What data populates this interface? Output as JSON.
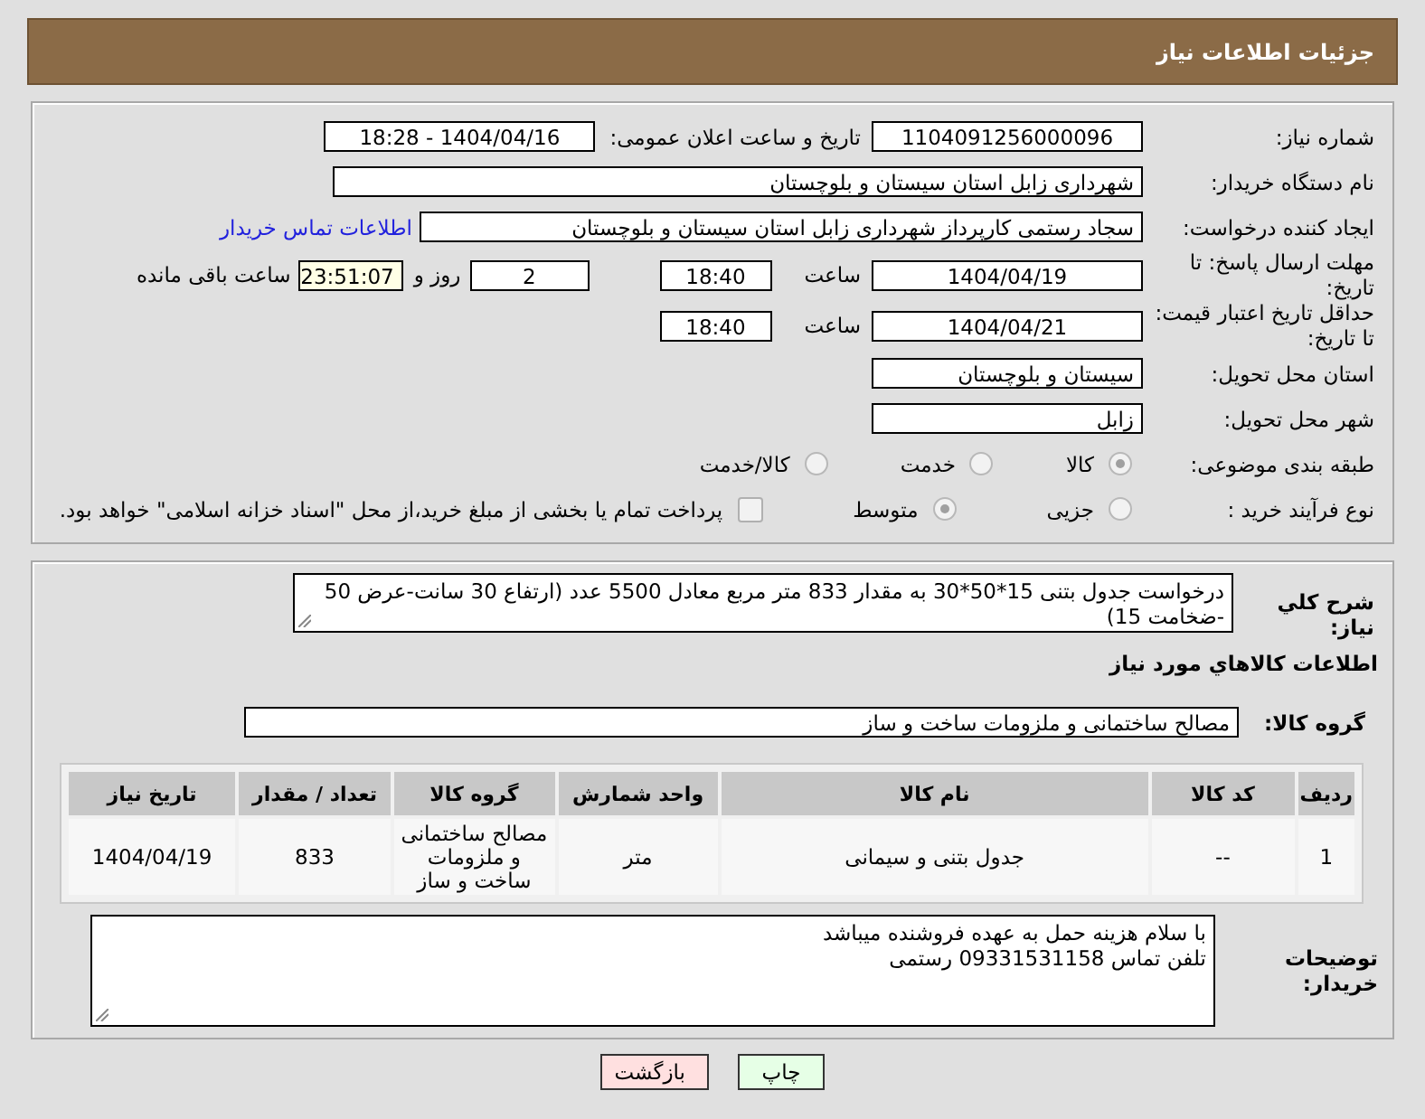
{
  "header": {
    "title": "جزئیات اطلاعات نیاز"
  },
  "form": {
    "need_number": {
      "label": "شماره نیاز:",
      "value": "1104091256000096"
    },
    "announce": {
      "label": "تاریخ و ساعت اعلان عمومی:",
      "value": "1404/04/16 - 18:28"
    },
    "buyer_org": {
      "label": "نام دستگاه خریدار:",
      "value": "شهرداری زابل استان سیستان و بلوچستان"
    },
    "requester": {
      "label": "ایجاد کننده درخواست:",
      "value": "سجاد رستمی کارپرداز شهرداری زابل استان سیستان و بلوچستان",
      "link": "اطلاعات تماس خریدار"
    },
    "deadline": {
      "label": "مهلت ارسال پاسخ: تا تاریخ:",
      "date": "1404/04/19",
      "time_label": "ساعت",
      "time": "18:40",
      "days": "2",
      "days_label": "روز و",
      "remaining": "23:51:07",
      "remaining_label": "ساعت باقی مانده"
    },
    "validity": {
      "label": "حداقل تاریخ اعتبار قیمت: تا تاریخ:",
      "date": "1404/04/21",
      "time_label": "ساعت",
      "time": "18:40"
    },
    "province": {
      "label": "استان محل تحویل:",
      "value": "سیستان و بلوچستان"
    },
    "city": {
      "label": "شهر محل تحویل:",
      "value": "زابل"
    },
    "category": {
      "label": "طبقه بندی موضوعی:",
      "options": [
        {
          "label": "کالا",
          "selected": true
        },
        {
          "label": "خدمت",
          "selected": false
        },
        {
          "label": "کالا/خدمت",
          "selected": false
        }
      ]
    },
    "process": {
      "label": "نوع فرآیند خرید :",
      "options": [
        {
          "label": "جزیی",
          "selected": false
        },
        {
          "label": "متوسط",
          "selected": true
        }
      ],
      "treasury": {
        "checked": false,
        "label": "پرداخت تمام یا بخشی از مبلغ خرید،از محل \"اسناد خزانه اسلامی\" خواهد بود."
      }
    }
  },
  "description": {
    "label": "شرح کلي نیاز:",
    "value": "درخواست جدول بتنی 15*50*30 به مقدار 833 متر مربع معادل 5500 عدد (ارتفاع 30 سانت-عرض 50 -ضخامت 15)"
  },
  "goods_title": "اطلاعات کالاهاي مورد نياز",
  "group": {
    "label": "گروه کالا:",
    "value": "مصالح ساختمانی و ملزومات ساخت و ساز"
  },
  "table": {
    "columns": [
      "ردیف",
      "کد کالا",
      "نام کالا",
      "واحد شمارش",
      "گروه کالا",
      "تعداد / مقدار",
      "تاریخ نیاز"
    ],
    "rows": [
      [
        "1",
        "--",
        "جدول بتنی و سیمانی",
        "متر",
        "مصالح ساختمانی و ملزومات ساخت و ساز",
        "833",
        "1404/04/19"
      ]
    ]
  },
  "buyer_notes": {
    "label": "توضیحات خریدار:",
    "lines": [
      "با سلام هزینه حمل به عهده فروشنده میباشد",
      "تلفن تماس 09331531158 رستمی"
    ]
  },
  "buttons": [
    {
      "kind": "print",
      "label": "چاپ"
    },
    {
      "kind": "back",
      "label": "بازگشت"
    }
  ]
}
